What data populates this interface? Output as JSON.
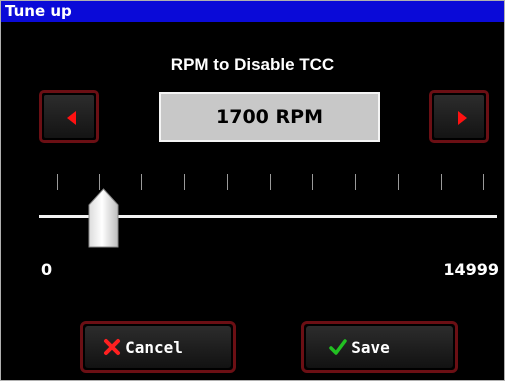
{
  "window": {
    "title": "Tune up"
  },
  "setting": {
    "label": "RPM to Disable TCC",
    "value_display": "1700 RPM",
    "value": 1700,
    "min": 0,
    "max": 14999,
    "min_label": "0",
    "max_label": "14999"
  },
  "buttons": {
    "decrease_icon": "left-triangle-icon",
    "increase_icon": "right-triangle-icon",
    "cancel_label": "Cancel",
    "cancel_icon": "red-x-icon",
    "save_label": "Save",
    "save_icon": "green-checkmark-icon"
  },
  "colors": {
    "titlebar": "#0a0ad8",
    "button_border": "#6b0f14",
    "arrow": "#ff1111",
    "cancel_x": "#ff2020",
    "save_check": "#22c022"
  }
}
